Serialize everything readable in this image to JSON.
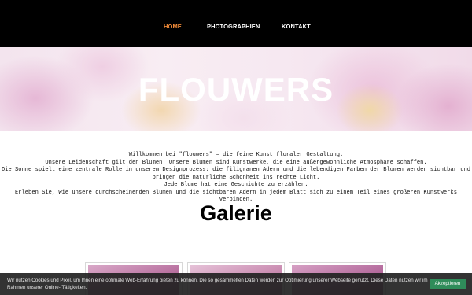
{
  "nav": {
    "items": [
      {
        "label": "HOME",
        "active": true
      },
      {
        "label": "PHOTOGRAPHIEN",
        "active": false
      },
      {
        "label": "KONTAKT",
        "active": false
      }
    ],
    "active_color": "#f08a38"
  },
  "hero": {
    "title": "FLOUWERS"
  },
  "intro": {
    "lines": [
      "Willkommen bei \"flouwers\" – die feine Kunst floraler Gestaltung.",
      "Unsere Leidenschaft gilt den Blumen. Unsere Blumen sind Kunstwerke, die eine außergewöhnliche Atmosphäre schaffen.",
      "Die Sonne spielt eine zentrale Rolle in unserem Designprozess: die filigranen Adern und die lebendigen Farben der Blumen werden sichtbar und",
      "bringen die natürliche Schönheit ins rechte Licht.",
      "Jede Blume hat eine Geschichte zu erzählen.",
      "Erleben Sie, wie unsere durchscheinenden Blumen und die sichtbaren Adern in jedem Blatt sich zu einem Teil eines größeren Kunstwerks verbinden."
    ]
  },
  "gallery": {
    "heading": "Galerie",
    "card_count": 3
  },
  "cookie": {
    "text": "Wir nutzen Cookies und Pixel, um Ihnen eine optimale Web-Erfahrung bieten zu können. Die so gesammelten Daten werden zur Optimierung unserer Webseite genutzt. Diese Daten nutzen wir im Rahmen unserer Online- Tätigkeiten.",
    "accept_label": "Akzeptieren",
    "accept_color": "#2f8c5a"
  }
}
